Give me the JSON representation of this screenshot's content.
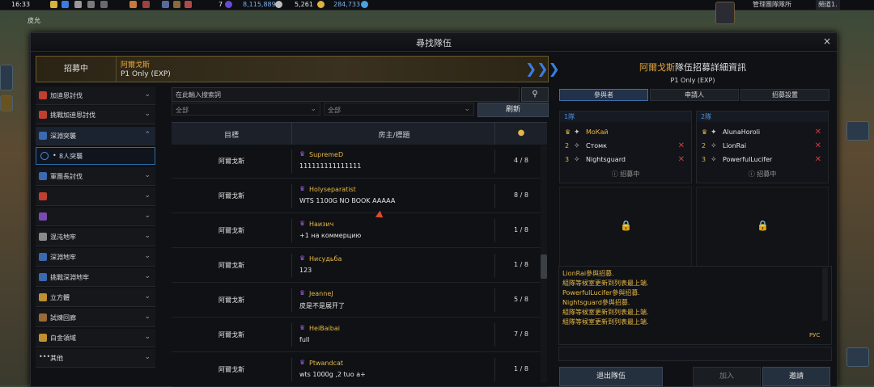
{
  "topbar": {
    "time": "16:33",
    "currency1": "7",
    "currency2": "8,115,889",
    "currency3": "5,261",
    "currency4": "284,733",
    "location": "管理團隊隊所",
    "server": "頻道1.",
    "corner_text": "皮允"
  },
  "window": {
    "title": "尋找隊伍",
    "close": "×"
  },
  "banner": {
    "status": "招募中",
    "raid_name": "阿爾戈斯",
    "condition": "P1 Only (EXP)",
    "arrow": "❯❯❯"
  },
  "sidebar": {
    "items": [
      {
        "label": "加迪恩討伐",
        "chev": "⌄"
      },
      {
        "label": "挑戰加迪恩討伐",
        "chev": "⌄"
      },
      {
        "label": "深淵突襲",
        "chev": "⌃"
      },
      {
        "label": "8人突襲",
        "chev": ""
      },
      {
        "label": "軍團長討伐",
        "chev": "⌄"
      },
      {
        "label": "",
        "chev": "⌄"
      },
      {
        "label": "",
        "chev": "⌄"
      },
      {
        "label": "混沌地牢",
        "chev": "⌄"
      },
      {
        "label": "深淵地牢",
        "chev": "⌄"
      },
      {
        "label": "挑戰深淵地牢",
        "chev": "⌄"
      },
      {
        "label": "立方體",
        "chev": "⌄"
      },
      {
        "label": "試煉回廊",
        "chev": "⌄"
      },
      {
        "label": "白金領域",
        "chev": "⌄"
      },
      {
        "label": "其他",
        "chev": "⌄"
      }
    ]
  },
  "search": {
    "placeholder": "在此輸入搜索詞",
    "filter1": "全部",
    "filter2": "全部",
    "refresh": "刷新"
  },
  "list": {
    "headers": {
      "target": "目標",
      "title": "房主/標題"
    },
    "rows": [
      {
        "target": "阿爾戈斯",
        "leader": "SupremeD",
        "title": "111111111111111",
        "count": "4 / 8"
      },
      {
        "target": "阿爾戈斯",
        "leader": "Holyseparatist",
        "title": "WTS 1100G NO BOOK AAAAA",
        "count": "8 / 8"
      },
      {
        "target": "阿爾戈斯",
        "leader": "Наизич",
        "title": "+1 на коммерцию",
        "count": "1 / 8"
      },
      {
        "target": "阿爾戈斯",
        "leader": "Нисудьба",
        "title": "123",
        "count": "1 / 8"
      },
      {
        "target": "阿爾戈斯",
        "leader": "JeanneJ",
        "title": "皮是不是展开了",
        "count": "5 / 8"
      },
      {
        "target": "阿爾戈斯",
        "leader": "HeiBaibai",
        "title": "full",
        "count": "7 / 8"
      },
      {
        "target": "阿爾戈斯",
        "leader": "Ptwandcat",
        "title": "wts 1000g ,2 tuo a+",
        "count": "1 / 8"
      }
    ]
  },
  "detail": {
    "raid_name": "阿爾戈斯",
    "title_suffix": "隊伍招募詳細資訊",
    "condition": "P1 Only (EXP)",
    "tabs": [
      "參與者",
      "申請人",
      "招募設置"
    ],
    "party1": {
      "label": "1隊",
      "members": [
        {
          "no": "",
          "name": "МоКай"
        },
        {
          "no": "2",
          "name": "Стомк"
        },
        {
          "no": "3",
          "name": "Nightsguard"
        }
      ],
      "recruiting": "招募中"
    },
    "party2": {
      "label": "2隊",
      "members": [
        {
          "no": "",
          "name": "AlunaHoroli"
        },
        {
          "no": "2",
          "name": "LionRai"
        },
        {
          "no": "3",
          "name": "PowerfulLucifer"
        }
      ],
      "recruiting": "招募中"
    },
    "log": [
      "LionRai參與招募.",
      "組隊等候室更新到列表最上端.",
      "PowerfulLucifer參與招募.",
      "Nightsguard參與招募.",
      "組隊等候室更新到列表最上端.",
      "組隊等候室更新到列表最上端."
    ],
    "log_lang": "РУС",
    "buttons": {
      "leave": "退出隊伍",
      "join": "加入",
      "invite": "邀請"
    }
  },
  "colors": {
    "accent_gold": "#e6a53a",
    "party_blue": "#4a90e2",
    "kick_red": "#d23a3a"
  }
}
